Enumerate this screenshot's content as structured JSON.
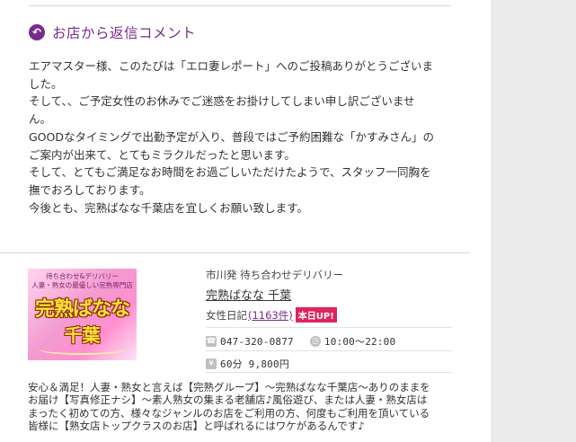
{
  "reply": {
    "title": "お店から返信コメント",
    "lines": [
      "エアマスター様、このたびは「エロ妻レポート」へのご投稿ありがとうございま",
      "した。",
      "そして、、ご予定女性のお休みでご迷惑をお掛けしてしまい申し訳ございませ",
      "ん。",
      "GOODなタイミングで出勤予定が入り、普段ではご予約困難な「かすみさん」の",
      "ご案内が出来て、とてもミラクルだったと思います。",
      "そして、とてもご満足なお時間をお過ごしいただけたようで、スタッフ一同胸を",
      "撫でおろしております。",
      "今後とも、完熟ばなな千葉店を宜しくお願い致します。"
    ]
  },
  "shop": {
    "logo": {
      "top_text_1": "待ち合わせ&デリバリー",
      "top_text_2": "人妻・熟女の最優しい完熟専門店",
      "main_text": "完熟ばなな",
      "sub_text": "千葉"
    },
    "area": "市川発 待ち合わせデリバリー",
    "name": "完熟ばなな 千葉",
    "diary_label": "女性日記",
    "diary_count": "(1163件)",
    "today_badge": "本日UP!",
    "phone": "047-320-0877",
    "hours": "10:00～22:00",
    "price": "60分 9,800円",
    "description_lines": [
      "安心＆満足！人妻・熟女と言えば【完熟グループ】～完熟ばなな千葉店～ありのままを",
      "お届け【写真修正ナシ】～素人熟女の集まる老舗店♪風俗遊び、または人妻・熟女店は",
      "まったく初めての方、様々なジャンルのお店をご利用の方、何度もご利用を頂いている",
      "皆様に【熟女店トップクラスのお店】と呼ばれるにはワケがあるんです♪"
    ]
  },
  "icons": {
    "reply": "reply-arrow-icon",
    "phone": "phone-icon",
    "clock": "clock-icon",
    "yen": "yen-icon"
  },
  "colors": {
    "accent": "#7a2a8e",
    "badge": "#e0245e"
  }
}
